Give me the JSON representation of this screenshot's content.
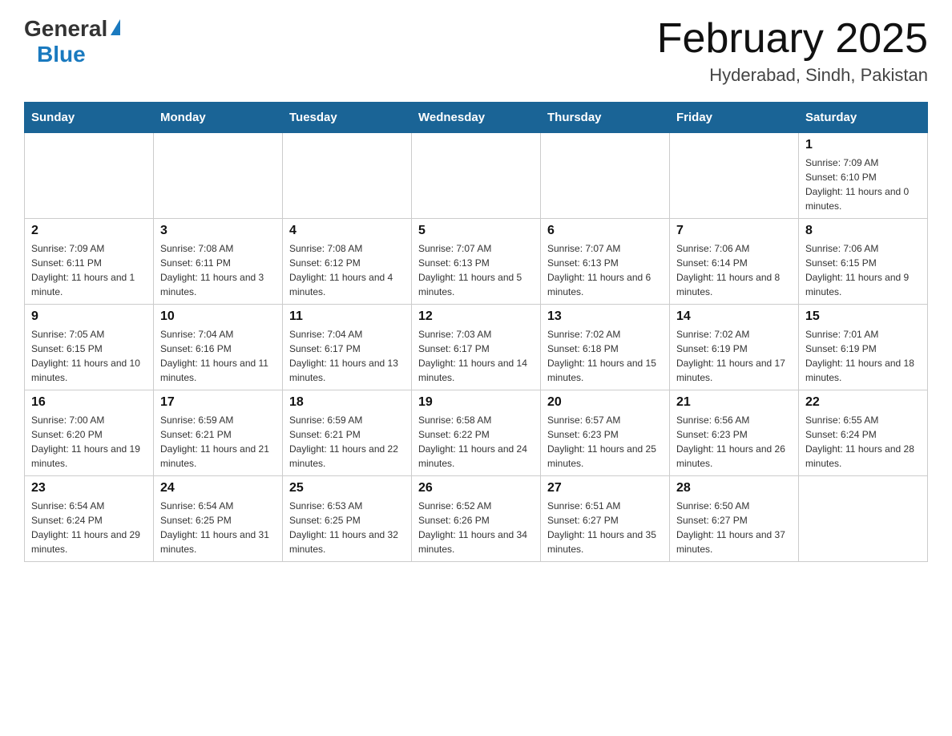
{
  "header": {
    "logo_general": "General",
    "logo_blue": "Blue",
    "title": "February 2025",
    "location": "Hyderabad, Sindh, Pakistan"
  },
  "days_of_week": [
    "Sunday",
    "Monday",
    "Tuesday",
    "Wednesday",
    "Thursday",
    "Friday",
    "Saturday"
  ],
  "weeks": [
    [
      {
        "day": "",
        "sunrise": "",
        "sunset": "",
        "daylight": ""
      },
      {
        "day": "",
        "sunrise": "",
        "sunset": "",
        "daylight": ""
      },
      {
        "day": "",
        "sunrise": "",
        "sunset": "",
        "daylight": ""
      },
      {
        "day": "",
        "sunrise": "",
        "sunset": "",
        "daylight": ""
      },
      {
        "day": "",
        "sunrise": "",
        "sunset": "",
        "daylight": ""
      },
      {
        "day": "",
        "sunrise": "",
        "sunset": "",
        "daylight": ""
      },
      {
        "day": "1",
        "sunrise": "Sunrise: 7:09 AM",
        "sunset": "Sunset: 6:10 PM",
        "daylight": "Daylight: 11 hours and 0 minutes."
      }
    ],
    [
      {
        "day": "2",
        "sunrise": "Sunrise: 7:09 AM",
        "sunset": "Sunset: 6:11 PM",
        "daylight": "Daylight: 11 hours and 1 minute."
      },
      {
        "day": "3",
        "sunrise": "Sunrise: 7:08 AM",
        "sunset": "Sunset: 6:11 PM",
        "daylight": "Daylight: 11 hours and 3 minutes."
      },
      {
        "day": "4",
        "sunrise": "Sunrise: 7:08 AM",
        "sunset": "Sunset: 6:12 PM",
        "daylight": "Daylight: 11 hours and 4 minutes."
      },
      {
        "day": "5",
        "sunrise": "Sunrise: 7:07 AM",
        "sunset": "Sunset: 6:13 PM",
        "daylight": "Daylight: 11 hours and 5 minutes."
      },
      {
        "day": "6",
        "sunrise": "Sunrise: 7:07 AM",
        "sunset": "Sunset: 6:13 PM",
        "daylight": "Daylight: 11 hours and 6 minutes."
      },
      {
        "day": "7",
        "sunrise": "Sunrise: 7:06 AM",
        "sunset": "Sunset: 6:14 PM",
        "daylight": "Daylight: 11 hours and 8 minutes."
      },
      {
        "day": "8",
        "sunrise": "Sunrise: 7:06 AM",
        "sunset": "Sunset: 6:15 PM",
        "daylight": "Daylight: 11 hours and 9 minutes."
      }
    ],
    [
      {
        "day": "9",
        "sunrise": "Sunrise: 7:05 AM",
        "sunset": "Sunset: 6:15 PM",
        "daylight": "Daylight: 11 hours and 10 minutes."
      },
      {
        "day": "10",
        "sunrise": "Sunrise: 7:04 AM",
        "sunset": "Sunset: 6:16 PM",
        "daylight": "Daylight: 11 hours and 11 minutes."
      },
      {
        "day": "11",
        "sunrise": "Sunrise: 7:04 AM",
        "sunset": "Sunset: 6:17 PM",
        "daylight": "Daylight: 11 hours and 13 minutes."
      },
      {
        "day": "12",
        "sunrise": "Sunrise: 7:03 AM",
        "sunset": "Sunset: 6:17 PM",
        "daylight": "Daylight: 11 hours and 14 minutes."
      },
      {
        "day": "13",
        "sunrise": "Sunrise: 7:02 AM",
        "sunset": "Sunset: 6:18 PM",
        "daylight": "Daylight: 11 hours and 15 minutes."
      },
      {
        "day": "14",
        "sunrise": "Sunrise: 7:02 AM",
        "sunset": "Sunset: 6:19 PM",
        "daylight": "Daylight: 11 hours and 17 minutes."
      },
      {
        "day": "15",
        "sunrise": "Sunrise: 7:01 AM",
        "sunset": "Sunset: 6:19 PM",
        "daylight": "Daylight: 11 hours and 18 minutes."
      }
    ],
    [
      {
        "day": "16",
        "sunrise": "Sunrise: 7:00 AM",
        "sunset": "Sunset: 6:20 PM",
        "daylight": "Daylight: 11 hours and 19 minutes."
      },
      {
        "day": "17",
        "sunrise": "Sunrise: 6:59 AM",
        "sunset": "Sunset: 6:21 PM",
        "daylight": "Daylight: 11 hours and 21 minutes."
      },
      {
        "day": "18",
        "sunrise": "Sunrise: 6:59 AM",
        "sunset": "Sunset: 6:21 PM",
        "daylight": "Daylight: 11 hours and 22 minutes."
      },
      {
        "day": "19",
        "sunrise": "Sunrise: 6:58 AM",
        "sunset": "Sunset: 6:22 PM",
        "daylight": "Daylight: 11 hours and 24 minutes."
      },
      {
        "day": "20",
        "sunrise": "Sunrise: 6:57 AM",
        "sunset": "Sunset: 6:23 PM",
        "daylight": "Daylight: 11 hours and 25 minutes."
      },
      {
        "day": "21",
        "sunrise": "Sunrise: 6:56 AM",
        "sunset": "Sunset: 6:23 PM",
        "daylight": "Daylight: 11 hours and 26 minutes."
      },
      {
        "day": "22",
        "sunrise": "Sunrise: 6:55 AM",
        "sunset": "Sunset: 6:24 PM",
        "daylight": "Daylight: 11 hours and 28 minutes."
      }
    ],
    [
      {
        "day": "23",
        "sunrise": "Sunrise: 6:54 AM",
        "sunset": "Sunset: 6:24 PM",
        "daylight": "Daylight: 11 hours and 29 minutes."
      },
      {
        "day": "24",
        "sunrise": "Sunrise: 6:54 AM",
        "sunset": "Sunset: 6:25 PM",
        "daylight": "Daylight: 11 hours and 31 minutes."
      },
      {
        "day": "25",
        "sunrise": "Sunrise: 6:53 AM",
        "sunset": "Sunset: 6:25 PM",
        "daylight": "Daylight: 11 hours and 32 minutes."
      },
      {
        "day": "26",
        "sunrise": "Sunrise: 6:52 AM",
        "sunset": "Sunset: 6:26 PM",
        "daylight": "Daylight: 11 hours and 34 minutes."
      },
      {
        "day": "27",
        "sunrise": "Sunrise: 6:51 AM",
        "sunset": "Sunset: 6:27 PM",
        "daylight": "Daylight: 11 hours and 35 minutes."
      },
      {
        "day": "28",
        "sunrise": "Sunrise: 6:50 AM",
        "sunset": "Sunset: 6:27 PM",
        "daylight": "Daylight: 11 hours and 37 minutes."
      },
      {
        "day": "",
        "sunrise": "",
        "sunset": "",
        "daylight": ""
      }
    ]
  ]
}
